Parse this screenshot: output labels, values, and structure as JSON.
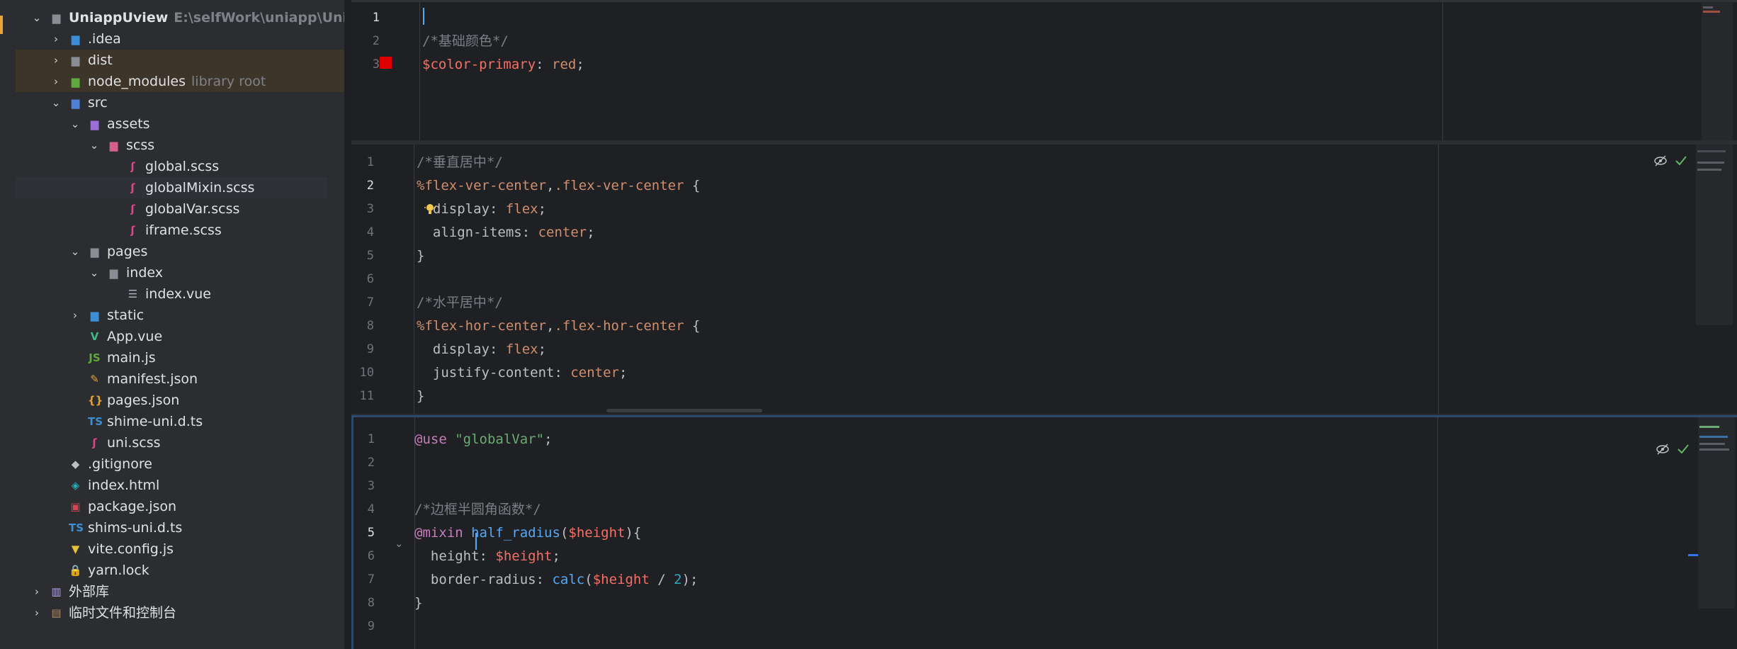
{
  "project_tree": {
    "rows": [
      {
        "indent": 0,
        "arrow": "⌄",
        "icon": "folder-icon",
        "label": "UniappUview",
        "path": "E:\\selfWork\\uniapp\\UniappUvi",
        "strong": true
      },
      {
        "indent": 1,
        "arrow": "›",
        "icon": "idea-folder-icon",
        "label": ".idea"
      },
      {
        "indent": 1,
        "arrow": "›",
        "icon": "folder-icon",
        "label": "dist",
        "hl": true
      },
      {
        "indent": 1,
        "arrow": "›",
        "icon": "node-folder-icon",
        "label": "node_modules",
        "note": "library root",
        "hl": true
      },
      {
        "indent": 1,
        "arrow": "⌄",
        "icon": "source-folder-icon",
        "label": "src"
      },
      {
        "indent": 2,
        "arrow": "⌄",
        "icon": "resource-folder-icon",
        "label": "assets"
      },
      {
        "indent": 3,
        "arrow": "⌄",
        "icon": "scss-folder-icon",
        "label": "scss"
      },
      {
        "indent": 4,
        "arrow": "",
        "icon": "scss-file-icon",
        "label": "global.scss"
      },
      {
        "indent": 4,
        "arrow": "",
        "icon": "scss-file-icon",
        "label": "globalMixin.scss",
        "sel": true
      },
      {
        "indent": 4,
        "arrow": "",
        "icon": "scss-file-icon",
        "label": "globalVar.scss"
      },
      {
        "indent": 4,
        "arrow": "",
        "icon": "scss-file-icon",
        "label": "iframe.scss"
      },
      {
        "indent": 2,
        "arrow": "⌄",
        "icon": "folder-icon",
        "label": "pages"
      },
      {
        "indent": 3,
        "arrow": "⌄",
        "icon": "folder-icon",
        "label": "index"
      },
      {
        "indent": 4,
        "arrow": "",
        "icon": "vue-file-icon",
        "label": "index.vue"
      },
      {
        "indent": 2,
        "arrow": "›",
        "icon": "web-folder-icon",
        "label": "static"
      },
      {
        "indent": 2,
        "arrow": "",
        "icon": "vue-logo-icon",
        "label": "App.vue"
      },
      {
        "indent": 2,
        "arrow": "",
        "icon": "js-file-icon",
        "label": "main.js"
      },
      {
        "indent": 2,
        "arrow": "",
        "icon": "json-file-icon",
        "label": "manifest.json"
      },
      {
        "indent": 2,
        "arrow": "",
        "icon": "json-braces-icon",
        "label": "pages.json"
      },
      {
        "indent": 2,
        "arrow": "",
        "icon": "ts-file-icon",
        "label": "shime-uni.d.ts"
      },
      {
        "indent": 2,
        "arrow": "",
        "icon": "scss-file-icon",
        "label": "uni.scss"
      },
      {
        "indent": 1,
        "arrow": "",
        "icon": "git-ignore-icon",
        "label": ".gitignore"
      },
      {
        "indent": 1,
        "arrow": "",
        "icon": "html-file-icon",
        "label": "index.html"
      },
      {
        "indent": 1,
        "arrow": "",
        "icon": "npm-file-icon",
        "label": "package.json"
      },
      {
        "indent": 1,
        "arrow": "",
        "icon": "ts-file-icon",
        "label": "shims-uni.d.ts"
      },
      {
        "indent": 1,
        "arrow": "",
        "icon": "vite-file-icon",
        "label": "vite.config.js"
      },
      {
        "indent": 1,
        "arrow": "",
        "icon": "yarn-lock-icon",
        "label": "yarn.lock"
      },
      {
        "indent": 0,
        "arrow": "›",
        "icon": "library-icon",
        "label": "外部库"
      },
      {
        "indent": 0,
        "arrow": "›",
        "icon": "scratches-icon",
        "label": "临时文件和控制台"
      }
    ]
  },
  "editors": {
    "top": {
      "lines": [
        {
          "n": "1",
          "tokens": []
        },
        {
          "n": "2",
          "tokens": [
            {
              "t": "/*基础颜色*/",
              "c": "c-comment"
            }
          ]
        },
        {
          "n": "3",
          "tokens": [
            {
              "t": "$color-primary",
              "c": "c-var"
            },
            {
              "t": ": ",
              "c": "c-prop"
            },
            {
              "t": "red",
              "c": "c-val"
            },
            {
              "t": ";",
              "c": "c-prop"
            }
          ]
        }
      ],
      "swatch_color": "#e00000"
    },
    "middle": {
      "lines": [
        {
          "n": "1",
          "tokens": [
            {
              "t": "/*垂直居中*/",
              "c": "c-comment"
            }
          ]
        },
        {
          "n": "2",
          "tokens": [
            {
              "t": "%flex-ver-center",
              "c": "c-sel"
            },
            {
              "t": ",",
              "c": "c-prop"
            },
            {
              "t": ".flex-ver-center",
              "c": "c-sel"
            },
            {
              "t": " {",
              "c": "c-prop"
            }
          ]
        },
        {
          "n": "3",
          "tokens": [
            {
              "t": "  display",
              "c": "c-prop"
            },
            {
              "t": ": ",
              "c": "c-prop"
            },
            {
              "t": "flex",
              "c": "c-val"
            },
            {
              "t": ";",
              "c": "c-prop"
            }
          ]
        },
        {
          "n": "4",
          "tokens": [
            {
              "t": "  align-items",
              "c": "c-prop"
            },
            {
              "t": ": ",
              "c": "c-prop"
            },
            {
              "t": "center",
              "c": "c-val"
            },
            {
              "t": ";",
              "c": "c-prop"
            }
          ]
        },
        {
          "n": "5",
          "tokens": [
            {
              "t": "}",
              "c": "c-prop"
            }
          ]
        },
        {
          "n": "6",
          "tokens": []
        },
        {
          "n": "7",
          "tokens": [
            {
              "t": "/*水平居中*/",
              "c": "c-comment"
            }
          ]
        },
        {
          "n": "8",
          "tokens": [
            {
              "t": "%flex-hor-center",
              "c": "c-sel"
            },
            {
              "t": ",",
              "c": "c-prop"
            },
            {
              "t": ".flex-hor-center",
              "c": "c-sel"
            },
            {
              "t": " {",
              "c": "c-prop"
            }
          ]
        },
        {
          "n": "9",
          "tokens": [
            {
              "t": "  display",
              "c": "c-prop"
            },
            {
              "t": ": ",
              "c": "c-prop"
            },
            {
              "t": "flex",
              "c": "c-val"
            },
            {
              "t": ";",
              "c": "c-prop"
            }
          ]
        },
        {
          "n": "10",
          "tokens": [
            {
              "t": "  justify-content",
              "c": "c-prop"
            },
            {
              "t": ": ",
              "c": "c-prop"
            },
            {
              "t": "center",
              "c": "c-val"
            },
            {
              "t": ";",
              "c": "c-prop"
            }
          ]
        },
        {
          "n": "11",
          "tokens": [
            {
              "t": "}",
              "c": "c-prop"
            }
          ]
        }
      ]
    },
    "bottom": {
      "lines": [
        {
          "n": "1",
          "tokens": [
            {
              "t": "@use",
              "c": "c-at"
            },
            {
              "t": " ",
              "c": "c-prop"
            },
            {
              "t": "\"globalVar\"",
              "c": "c-str"
            },
            {
              "t": ";",
              "c": "c-prop"
            }
          ]
        },
        {
          "n": "2",
          "tokens": []
        },
        {
          "n": "3",
          "tokens": []
        },
        {
          "n": "4",
          "tokens": [
            {
              "t": "/*边框半圆角函数*/",
              "c": "c-comment"
            }
          ]
        },
        {
          "n": "5",
          "tokens": [
            {
              "t": "@mixin",
              "c": "c-at"
            },
            {
              "t": " ",
              "c": "c-prop"
            },
            {
              "t": "half_radius",
              "c": "c-fn"
            },
            {
              "t": "(",
              "c": "c-prop"
            },
            {
              "t": "$height",
              "c": "c-var"
            },
            {
              "t": "){",
              "c": "c-prop"
            }
          ]
        },
        {
          "n": "6",
          "tokens": [
            {
              "t": "  height",
              "c": "c-prop"
            },
            {
              "t": ": ",
              "c": "c-prop"
            },
            {
              "t": "$height",
              "c": "c-var"
            },
            {
              "t": ";",
              "c": "c-prop"
            }
          ]
        },
        {
          "n": "7",
          "tokens": [
            {
              "t": "  border-radius",
              "c": "c-prop"
            },
            {
              "t": ": ",
              "c": "c-prop"
            },
            {
              "t": "calc",
              "c": "c-fn"
            },
            {
              "t": "(",
              "c": "c-prop"
            },
            {
              "t": "$height",
              "c": "c-var"
            },
            {
              "t": " / ",
              "c": "c-prop"
            },
            {
              "t": "2",
              "c": "c-num"
            },
            {
              "t": ");",
              "c": "c-prop"
            }
          ]
        },
        {
          "n": "8",
          "tokens": [
            {
              "t": "}",
              "c": "c-prop"
            }
          ]
        },
        {
          "n": "9",
          "tokens": []
        }
      ]
    }
  },
  "colors": {
    "comment": "#7a7e85",
    "variable": "#f47067",
    "keyword_value": "#cf8e6d",
    "string": "#6aab73",
    "at_rule": "#c77dbb",
    "function": "#56a8f5",
    "number": "#2aacb8"
  }
}
